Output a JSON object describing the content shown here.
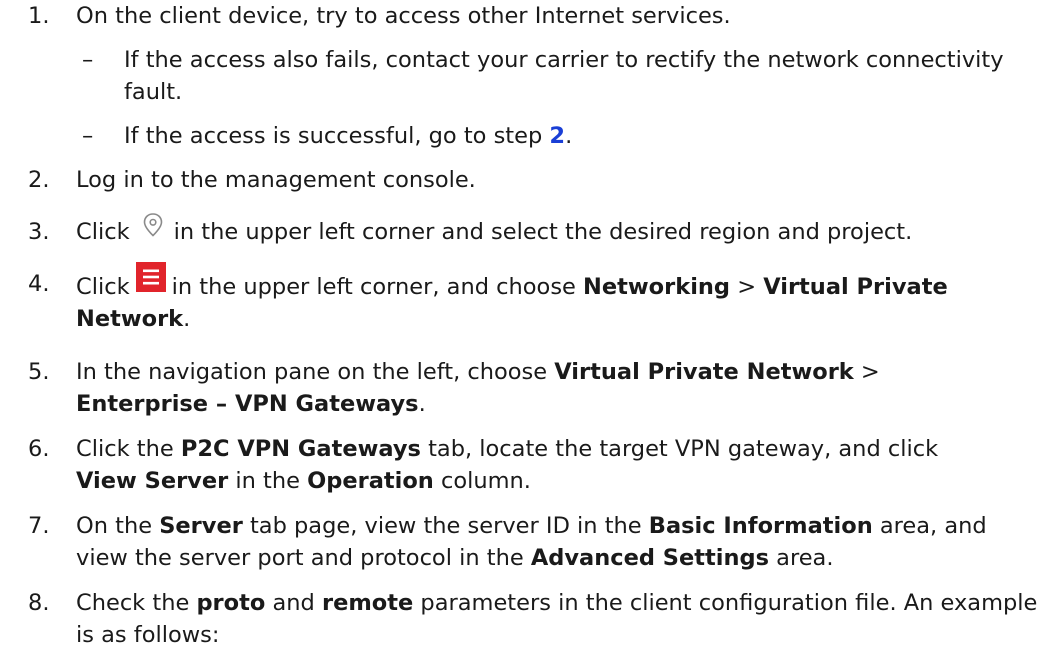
{
  "steps": [
    {
      "num": "1.",
      "text": "On the client device, try to access other Internet services."
    },
    {
      "num": "2.",
      "text": "Log in to the management console."
    },
    {
      "num": "3.",
      "a": "Click",
      "b": "in the upper left corner and select the desired region and project."
    },
    {
      "num": "4.",
      "a": "Click",
      "b": "in the upper left corner, and choose",
      "c": "Networking",
      "d": ">",
      "e": "Virtual Private Network",
      "f": "."
    },
    {
      "num": "5.",
      "a": "In the navigation pane on the left, choose",
      "b": "Virtual Private Network",
      "c": ">",
      "d": "Enterprise – VPN Gateways",
      "e": "."
    },
    {
      "num": "6.",
      "a": "Click the",
      "b": "P2C VPN Gateways",
      "c": "tab, locate the target VPN gateway, and click",
      "d": "View Server",
      "e": "in the",
      "f": "Operation",
      "g": "column."
    },
    {
      "num": "7.",
      "a": "On the",
      "b": "Server",
      "c": "tab page, view the server ID in the",
      "d": "Basic Information",
      "e": "area, and view the server port and protocol in the",
      "f": "Advanced Settings",
      "g": "area."
    },
    {
      "num": "8.",
      "a": "Check the",
      "b": "proto",
      "c": "and",
      "d": "remote",
      "e": "parameters in the client configuration file. An example is as follows:"
    }
  ],
  "substeps": [
    {
      "dash": "–",
      "text": "If the access also fails, contact your carrier to rectify the network connectivity fault."
    },
    {
      "dash": "–",
      "a": "If the access is successful, go to step",
      "link": "2",
      "b": "."
    }
  ],
  "icons": {
    "step3": "location-pin-icon",
    "step4": "hamburger-menu-icon"
  },
  "colors": {
    "text": "#1a1a1a",
    "link": "#1a3fd6",
    "menu_icon": "#e1242b",
    "pin_icon": "#8a8a8a"
  }
}
